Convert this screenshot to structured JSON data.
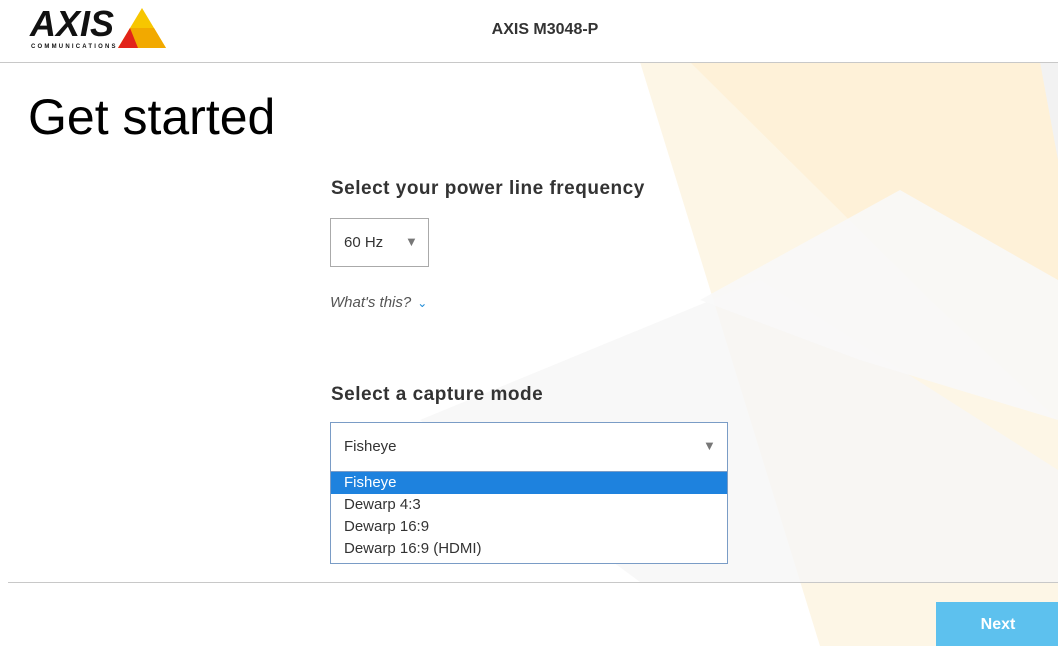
{
  "header": {
    "brand_name": "AXIS",
    "brand_sub": "COMMUNICATIONS",
    "device_model": "AXIS M3048-P"
  },
  "page": {
    "title": "Get started"
  },
  "power_frequency": {
    "label": "Select your power line frequency",
    "selected": "60 Hz",
    "help_link": "What's this?"
  },
  "capture_mode": {
    "label": "Select a capture mode",
    "selected": "Fisheye",
    "options": [
      "Fisheye",
      "Dewarp 4:3",
      "Dewarp 16:9",
      "Dewarp 16:9 (HDMI)"
    ],
    "highlighted_option": "Fisheye"
  },
  "footer": {
    "next_label": "Next"
  },
  "colors": {
    "accent": "#1e82de",
    "next_button": "#5dc1ee",
    "brand_yellow": "#f7c600",
    "brand_red": "#e2231a"
  },
  "icons": {
    "dropdown_arrow": "triangle-down-icon",
    "help_chevron": "chevron-down-icon"
  }
}
